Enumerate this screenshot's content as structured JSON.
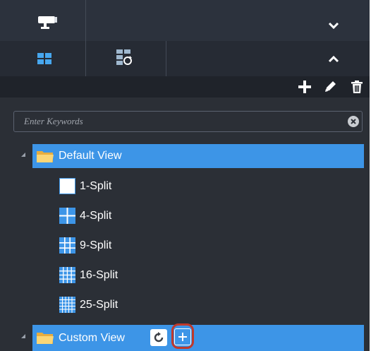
{
  "search": {
    "placeholder": "Enter Keywords"
  },
  "toolbar": {
    "add_icon": "plus-icon",
    "edit_icon": "pencil-icon",
    "delete_icon": "trash-icon"
  },
  "tabs": {
    "camera_icon": "camera-icon",
    "view_icon": "grid-view-icon",
    "view_play_icon": "view-play-icon",
    "collapse_icon": "chevron-down-icon",
    "expand_icon": "chevron-up-icon"
  },
  "tree": {
    "default_view": {
      "label": "Default View",
      "children": [
        {
          "label": "1-Split"
        },
        {
          "label": "4-Split"
        },
        {
          "label": "9-Split"
        },
        {
          "label": "16-Split"
        },
        {
          "label": "25-Split"
        }
      ]
    },
    "custom_view": {
      "label": "Custom View",
      "refresh_icon": "refresh-icon",
      "add_icon": "plus-icon"
    }
  },
  "colors": {
    "selected_row": "#3d95e7",
    "panel_bg": "#2b2f36",
    "highlight_ring": "#c0392b"
  }
}
